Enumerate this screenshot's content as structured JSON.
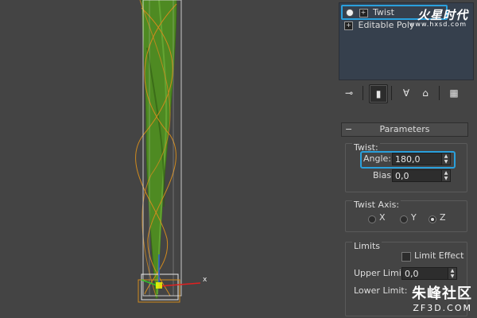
{
  "modifier_stack": {
    "items": [
      {
        "label": "Twist",
        "selected": true
      },
      {
        "label": "Editable Poly",
        "selected": false
      }
    ],
    "watermark": "火星时代",
    "watermark_url": "www.hxsd.com"
  },
  "toolbar": {
    "buttons": [
      "pin-stack-icon",
      "show-end-result-icon",
      "make-unique-icon",
      "remove-modifier-icon",
      "configure-modifier-sets-icon"
    ]
  },
  "parameters": {
    "rollout_title": "Parameters",
    "rollout_toggle": "−",
    "twist": {
      "group_label": "Twist:",
      "angle_label": "Angle:",
      "angle_value": "180,0",
      "bias_label": "Bias:",
      "bias_value": "0,0"
    },
    "twist_axis": {
      "group_label": "Twist Axis:",
      "options": [
        {
          "label": "X",
          "selected": false
        },
        {
          "label": "Y",
          "selected": false
        },
        {
          "label": "Z",
          "selected": true
        }
      ]
    },
    "limits": {
      "group_label": "Limits",
      "limit_effect_label": "Limit Effect",
      "limit_effect_checked": false,
      "upper_label": "Upper Limit:",
      "upper_value": "0,0",
      "lower_label": "Lower Limit:"
    }
  },
  "watermark2": {
    "cn": "朱峰社区",
    "en": "ZF3D.COM"
  },
  "viewport": {
    "axis_x_label": "x"
  },
  "colors": {
    "accent": "#2aa0dc",
    "object_green": "#4f8a1f",
    "gizmo_orange": "#d08a1e"
  }
}
